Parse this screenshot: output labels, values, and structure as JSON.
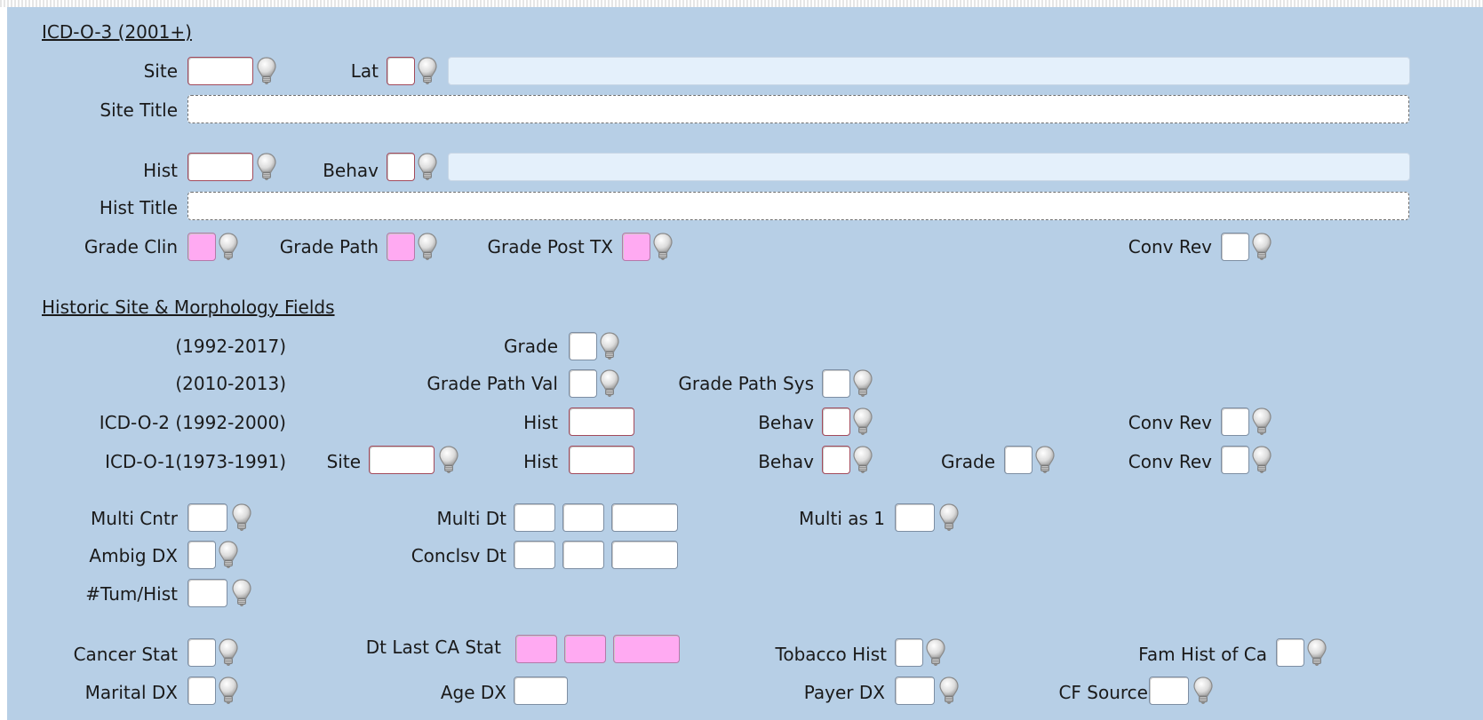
{
  "icdo3": {
    "header": "ICD-O-3 (2001+)",
    "site_label": "Site",
    "lat_label": "Lat",
    "site_title_label": "Site Title",
    "hist_label": "Hist",
    "behav_label": "Behav",
    "hist_title_label": "Hist Title",
    "grade_clin_label": "Grade Clin",
    "grade_path_label": "Grade Path",
    "grade_post_tx_label": "Grade Post TX",
    "conv_rev_label": "Conv Rev"
  },
  "historic": {
    "header": "Historic Site & Morphology Fields",
    "row1_period": "(1992-2017)",
    "row1_grade_label": "Grade",
    "row2_period": "(2010-2013)",
    "row2_grade_path_val_label": "Grade Path Val",
    "row2_grade_path_sys_label": "Grade Path Sys",
    "row3_period": "ICD-O-2 (1992-2000)",
    "row3_hist_label": "Hist",
    "row3_behav_label": "Behav",
    "row3_conv_rev_label": "Conv Rev",
    "row4_period": "ICD-O-1(1973-1991)",
    "row4_site_label": "Site",
    "row4_hist_label": "Hist",
    "row4_behav_label": "Behav",
    "row4_grade_label": "Grade",
    "row4_conv_rev_label": "Conv Rev"
  },
  "multi": {
    "multi_cntr_label": "Multi Cntr",
    "multi_dt_label": "Multi Dt",
    "multi_as_1_label": "Multi as 1",
    "ambig_dx_label": "Ambig DX",
    "conclsv_dt_label": "Conclsv Dt",
    "tum_hist_label": "#Tum/Hist"
  },
  "status": {
    "cancer_stat_label": "Cancer Stat",
    "dt_last_ca_stat_label": "Dt Last CA Stat",
    "tobacco_hist_label": "Tobacco Hist",
    "fam_hist_label": "Fam Hist of Ca",
    "marital_dx_label": "Marital DX",
    "age_dx_label": "Age DX",
    "payer_dx_label": "Payer DX",
    "cf_source_label": "CF Source"
  },
  "colors": {
    "panel_bg": "#b7cfe6",
    "required_field": "#ffaaf2",
    "info_field": "#e4f0fb"
  },
  "icons": {
    "help": "lightbulb-icon"
  }
}
